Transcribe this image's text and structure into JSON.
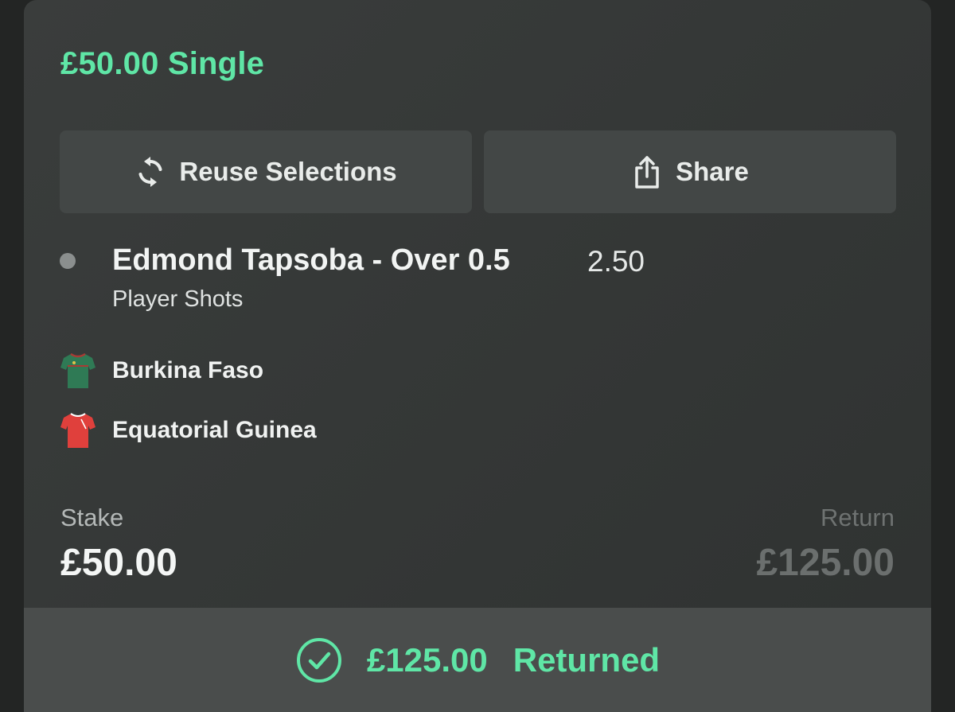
{
  "bet": {
    "title": "£50.00 Single"
  },
  "actions": {
    "reuse_label": "Reuse Selections",
    "share_label": "Share"
  },
  "selection": {
    "name": "Edmond Tapsoba - Over 0.5",
    "odds": "2.50",
    "market": "Player Shots"
  },
  "teams": {
    "home": {
      "name": "Burkina Faso",
      "shirt_color": "#2f7a55"
    },
    "away": {
      "name": "Equatorial Guinea",
      "shirt_color": "#e0403c"
    }
  },
  "stake": {
    "label": "Stake",
    "value": "£50.00"
  },
  "return": {
    "label": "Return",
    "value": "£125.00"
  },
  "result": {
    "amount": "£125.00",
    "status": "Returned",
    "icon": "check-circle-icon"
  },
  "colors": {
    "accent": "#5fe6a6",
    "card_bg": "#353837",
    "button_bg": "#434746",
    "footer_bg": "#4a4d4c"
  }
}
